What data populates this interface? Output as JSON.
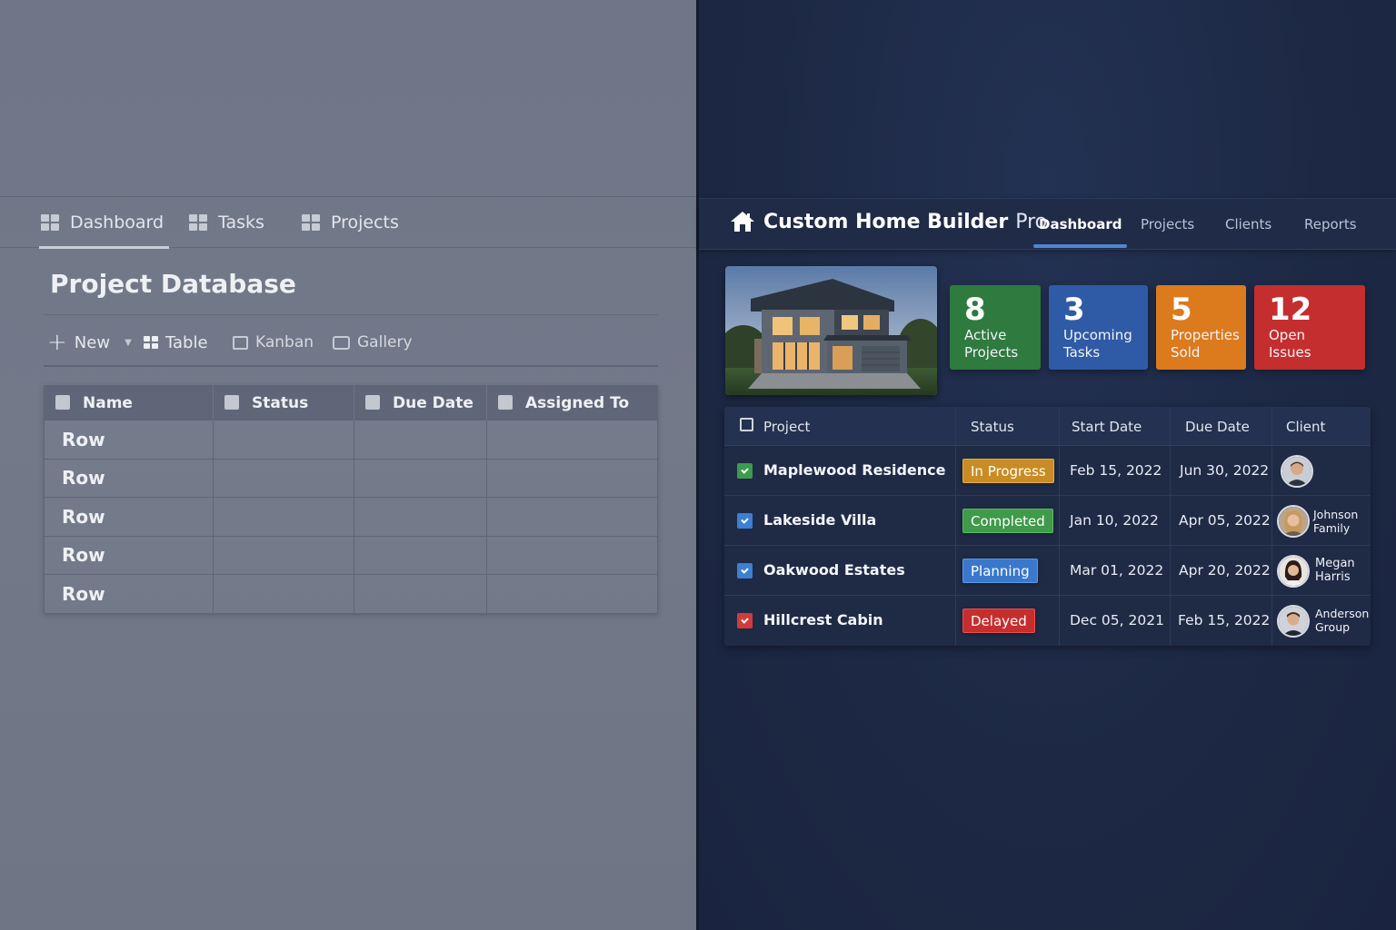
{
  "left": {
    "nav": [
      {
        "label": "Dashboard",
        "active": true
      },
      {
        "label": "Tasks",
        "active": false
      },
      {
        "label": "Projects",
        "active": false
      }
    ],
    "title": "Project Database",
    "toolbar": {
      "new_label": "New",
      "views": [
        "Table",
        "Kanban",
        "Gallery"
      ]
    },
    "table": {
      "columns": [
        "Name",
        "Status",
        "Due Date",
        "Assigned To"
      ],
      "rows": [
        "Row",
        "Row",
        "Row",
        "Row",
        "Row"
      ]
    }
  },
  "right": {
    "brand": {
      "name": "Custom Home Builder",
      "suffix": "Pro"
    },
    "nav": [
      {
        "label": "Dashboard",
        "active": true
      },
      {
        "label": "Projects",
        "active": false
      },
      {
        "label": "Clients",
        "active": false
      },
      {
        "label": "Reports",
        "active": false
      }
    ],
    "stats": [
      {
        "value": "8",
        "label": "Active\nProjects",
        "color": "#2f7a3e"
      },
      {
        "value": "3",
        "label": "Upcoming\nTasks",
        "color": "#2f5aa6"
      },
      {
        "value": "5",
        "label": "Properties\nSold",
        "color": "#dc7a1e"
      },
      {
        "value": "12",
        "label": "Open\nIssues",
        "color": "#c42e2e"
      }
    ],
    "table": {
      "columns": [
        "Project",
        "Status",
        "Start Date",
        "Due Date",
        "Client"
      ],
      "rows": [
        {
          "project": "Maplewood Residence",
          "status": "In Progress",
          "status_color": "#c98c24",
          "start": "Feb 15, 2022",
          "due": "Jun 30, 2022",
          "client": "",
          "icon_color": "#3e9a4d"
        },
        {
          "project": "Lakeside Villa",
          "status": "Completed",
          "status_color": "#3f9a49",
          "start": "Jan 10, 2022",
          "due": "Apr 05, 2022",
          "client": "Johnson\nFamily",
          "icon_color": "#3d7fd0"
        },
        {
          "project": "Oakwood Estates",
          "status": "Planning",
          "status_color": "#3978cc",
          "start": "Mar 01, 2022",
          "due": "Apr 20, 2022",
          "client": "Megan\nHarris",
          "icon_color": "#3d7fd0"
        },
        {
          "project": "Hillcrest Cabin",
          "status": "Delayed",
          "status_color": "#c62e2e",
          "start": "Dec 05, 2021",
          "due": "Feb 15, 2022",
          "client": "Anderson\nGroup",
          "icon_color": "#d23b3b"
        }
      ]
    }
  }
}
